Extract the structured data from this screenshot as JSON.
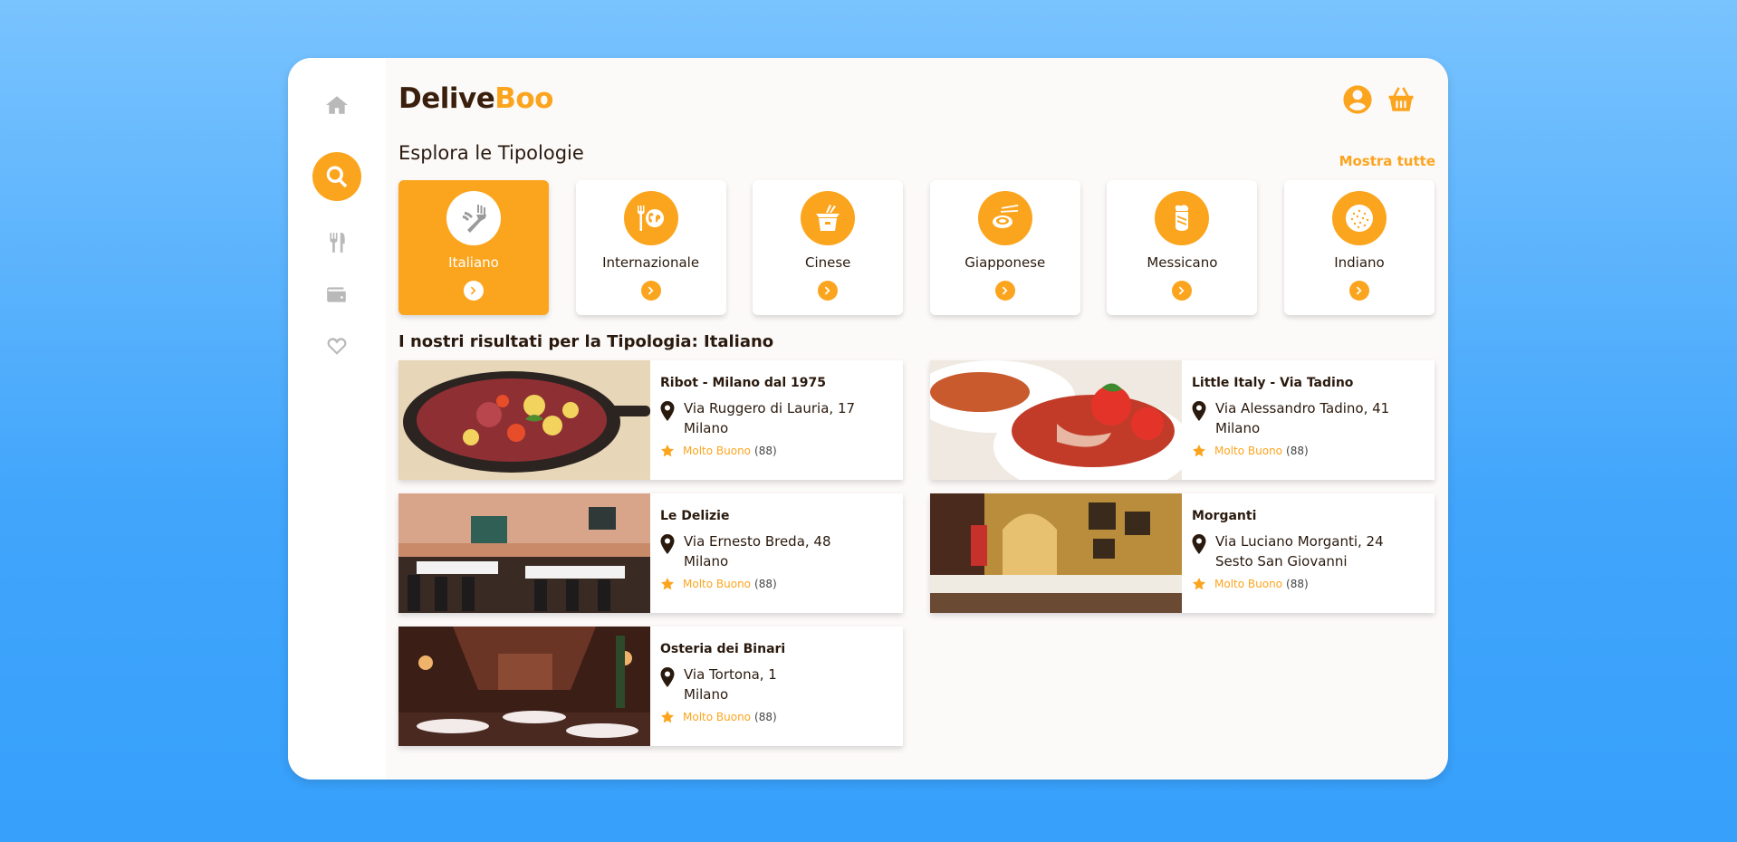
{
  "logo": {
    "part1": "Delive",
    "part2": "Boo"
  },
  "sidebar": {
    "items": [
      {
        "icon": "home-icon"
      },
      {
        "icon": "search-icon"
      },
      {
        "icon": "utensils-icon"
      },
      {
        "icon": "wallet-icon"
      },
      {
        "icon": "heart-icon"
      }
    ]
  },
  "header": {
    "user_icon": "user-circle-icon",
    "cart_icon": "basket-icon"
  },
  "types_section": {
    "title": "Esplora le Tipologie",
    "show_all": "Mostra tutte",
    "types": [
      {
        "label": "Italiano",
        "icon": "pasta-fork-icon",
        "active": true
      },
      {
        "label": "Internazionale",
        "icon": "globe-utensils-icon",
        "active": false
      },
      {
        "label": "Cinese",
        "icon": "takeout-box-icon",
        "active": false
      },
      {
        "label": "Giapponese",
        "icon": "sushi-chopsticks-icon",
        "active": false
      },
      {
        "label": "Messicano",
        "icon": "burrito-icon",
        "active": false
      },
      {
        "label": "Indiano",
        "icon": "naan-icon",
        "active": false
      }
    ]
  },
  "results": {
    "title": "I nostri risultati per la Tipologia: Italiano",
    "restaurants": [
      {
        "name": "Ribot - Milano dal 1975",
        "address": "Via Ruggero di Lauria, 17",
        "city": "Milano",
        "rating_label": "Molto Buono",
        "rating_count": "(88)"
      },
      {
        "name": "Little Italy - Via Tadino",
        "address": "Via Alessandro Tadino, 41",
        "city": "Milano",
        "rating_label": "Molto Buono",
        "rating_count": "(88)"
      },
      {
        "name": "Le Delizie",
        "address": "Via Ernesto Breda, 48",
        "city": "Milano",
        "rating_label": "Molto Buono",
        "rating_count": "(88)"
      },
      {
        "name": "Morganti",
        "address": "Via Luciano Morganti, 24",
        "city": "Sesto San Giovanni",
        "rating_label": "Molto Buono",
        "rating_count": "(88)"
      },
      {
        "name": "Osteria dei Binari",
        "address": "Via Tortona, 1",
        "city": "Milano",
        "rating_label": "Molto Buono",
        "rating_count": "(88)"
      }
    ]
  },
  "colors": {
    "accent": "#fba51f",
    "dark_text": "#2a1a0e",
    "background_top": "#79c3fe",
    "background_bottom": "#36a0fb"
  }
}
